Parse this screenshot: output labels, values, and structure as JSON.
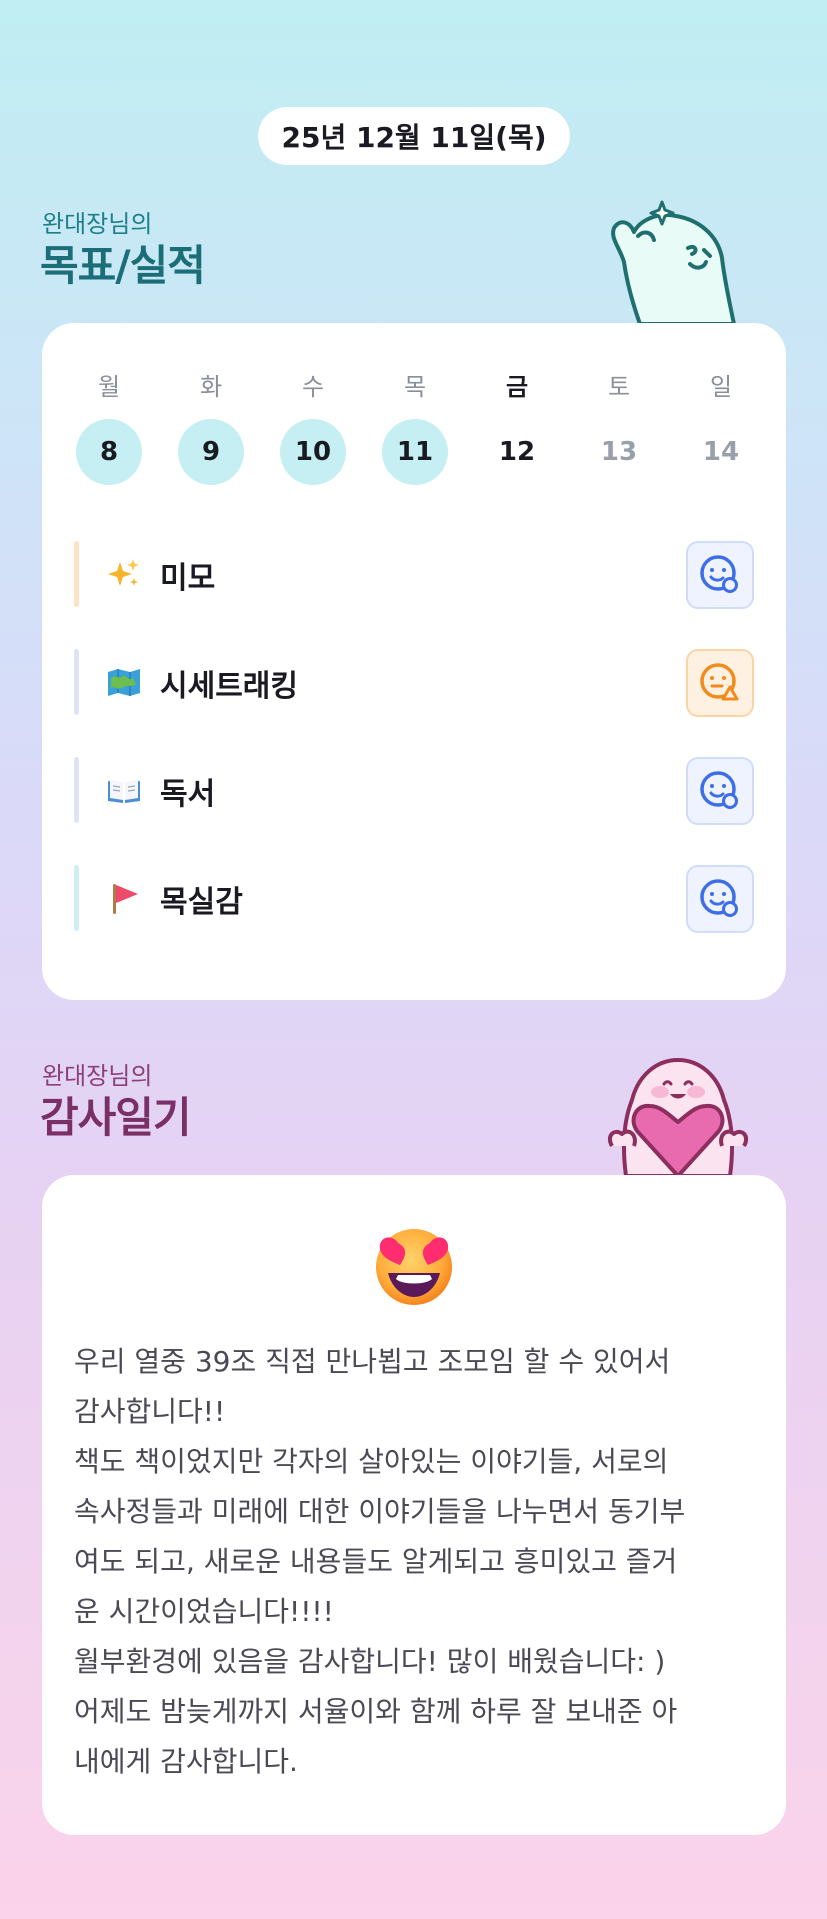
{
  "date": "25년 12월 11일(목)",
  "goals_section": {
    "owner": "완대장님의",
    "title": "목표/실적",
    "week": [
      {
        "label": "월",
        "num": "8",
        "state": "done"
      },
      {
        "label": "화",
        "num": "9",
        "state": "done"
      },
      {
        "label": "수",
        "num": "10",
        "state": "done"
      },
      {
        "label": "목",
        "num": "11",
        "state": "done"
      },
      {
        "label": "금",
        "num": "12",
        "state": "today"
      },
      {
        "label": "토",
        "num": "13",
        "state": "future"
      },
      {
        "label": "일",
        "num": "14",
        "state": "future"
      }
    ],
    "goals": [
      {
        "icon": "sparkles-emoji-icon",
        "name": "미모",
        "status": "smile-check",
        "bar_color": "#fde3c2"
      },
      {
        "icon": "map-emoji-icon",
        "name": "시세트래킹",
        "status": "warning",
        "bar_color": "#dfe3f7"
      },
      {
        "icon": "open-book-emoji-icon",
        "name": "독서",
        "status": "smile-check",
        "bar_color": "#dfe3f7"
      },
      {
        "icon": "red-flag-emoji-icon",
        "name": "목실감",
        "status": "smile-check",
        "bar_color": "#cdeff3"
      }
    ]
  },
  "gratitude_section": {
    "owner": "완대장님의",
    "title": "감사일기",
    "mood_icon": "heart-eyes-emoji-icon",
    "lines": [
      "우리 열중 39조 직접 만나뵙고 조모임 할 수 있어서",
      "감사합니다!!",
      "책도 책이었지만 각자의 살아있는 이야기들, 서로의",
      "속사정들과 미래에 대한 이야기들을 나누면서 동기부",
      "여도 되고, 새로운 내용들도 알게되고 흥미있고 즐거",
      "운 시간이었습니다!!!!",
      "월부환경에 있음을 감사합니다! 많이 배웠습니다: )",
      "어제도 밤늦게까지 서율이와 함께 하루 잘 보내준 아",
      "내에게 감사합니다."
    ]
  },
  "colors": {
    "teal_accent": "#1f7f89",
    "plum_accent": "#8c3f78",
    "done_circle": "#c5eff3",
    "status_blue": "#3d6ee8",
    "status_orange": "#f28a1c"
  }
}
